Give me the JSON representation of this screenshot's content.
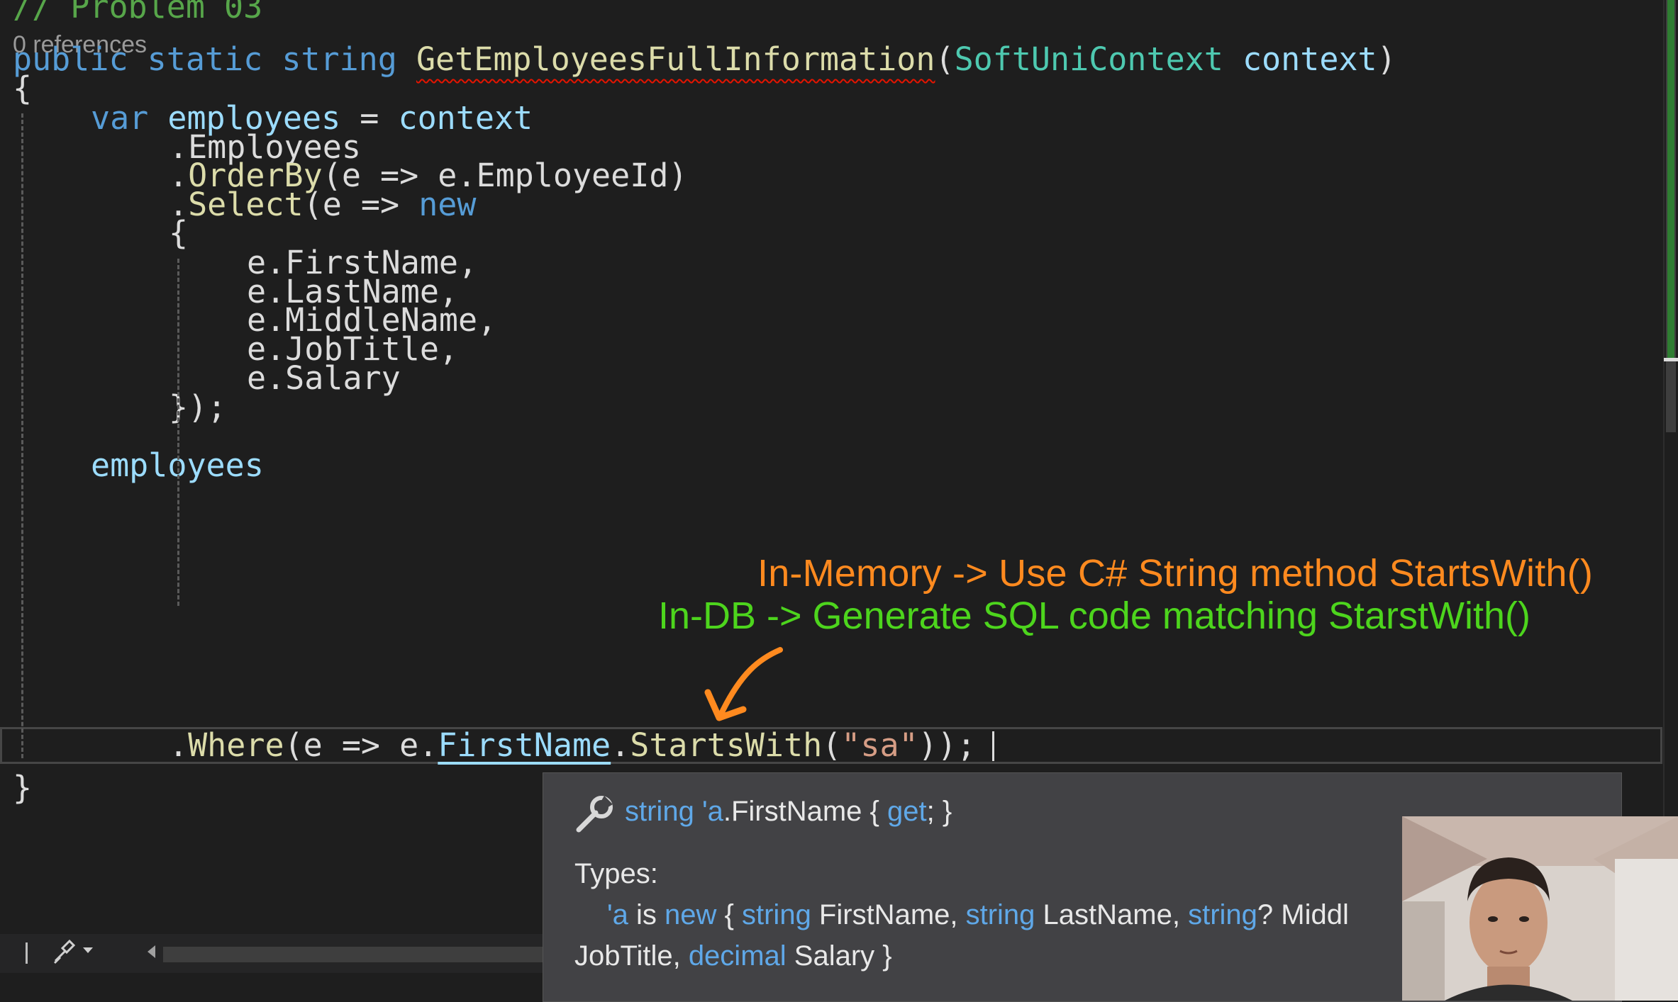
{
  "editor": {
    "comment": "// Problem 03",
    "codelens": "0 references",
    "sig": {
      "public": "public",
      "static": "static",
      "string": "string",
      "method": "GetEmployeesFullInformation",
      "paren_open": "(",
      "param_type": "SoftUniContext",
      "param_name": "context",
      "paren_close": ")"
    },
    "brace_open": "{",
    "l5": {
      "var": "var",
      "name": "employees",
      "eq": " = ",
      "ctx": "context"
    },
    "l6": ".Employees",
    "l7": {
      "dot": ".",
      "method": "OrderBy",
      "rest": "(e => e.EmployeeId)"
    },
    "l8": {
      "dot": ".",
      "method": "Select",
      "rest": "(e => ",
      "new": "new"
    },
    "l9": "{",
    "l10": "e.FirstName,",
    "l11": "e.LastName,",
    "l12": "e.MiddleName,",
    "l13": "e.JobTitle,",
    "l14": "e.Salary",
    "l15": "});",
    "l17": "employees",
    "l18": {
      "dot": ".",
      "where": "Where",
      "a": "(e => e.",
      "firstname": "FirstName",
      "dot2": ".",
      "startswith": "StartsWith",
      "p1": "(",
      "str": "\"sa\"",
      "end": "));"
    },
    "brace_close": "}"
  },
  "annotations": {
    "orange": "In-Memory -> Use C# String method StartsWith()",
    "green": "In-DB -> Generate SQL code matching StarstWith()"
  },
  "tooltip": {
    "l1_type": "string",
    "l1_q": "'a",
    "l1_member": ".FirstName { ",
    "l1_get": "get",
    "l1_end": "; }",
    "types_label": "Types:",
    "l3_a": "'a",
    "l3_is": " is ",
    "l3_new": "new",
    "l3_b": " { ",
    "l3_s1": "string",
    "l3_f1": " FirstName, ",
    "l3_s2": "string",
    "l3_f2": " LastName, ",
    "l3_s3": "string",
    "l3_f3": "? Middl",
    "l4_a": "JobTitle, ",
    "l4_dec": "decimal",
    "l4_b": " Salary }"
  },
  "colors": {
    "background": "#1e1e1e",
    "keyword": "#569cd6",
    "type": "#4ec9b0",
    "method": "#dcdcaa",
    "string": "#d69d85",
    "comment": "#57a64a",
    "annotation_orange": "#ff8a1f",
    "annotation_green": "#4dd51d"
  },
  "icons": [
    "wrench-icon",
    "arrow-icon",
    "brush-icon",
    "scroll-left-icon"
  ]
}
